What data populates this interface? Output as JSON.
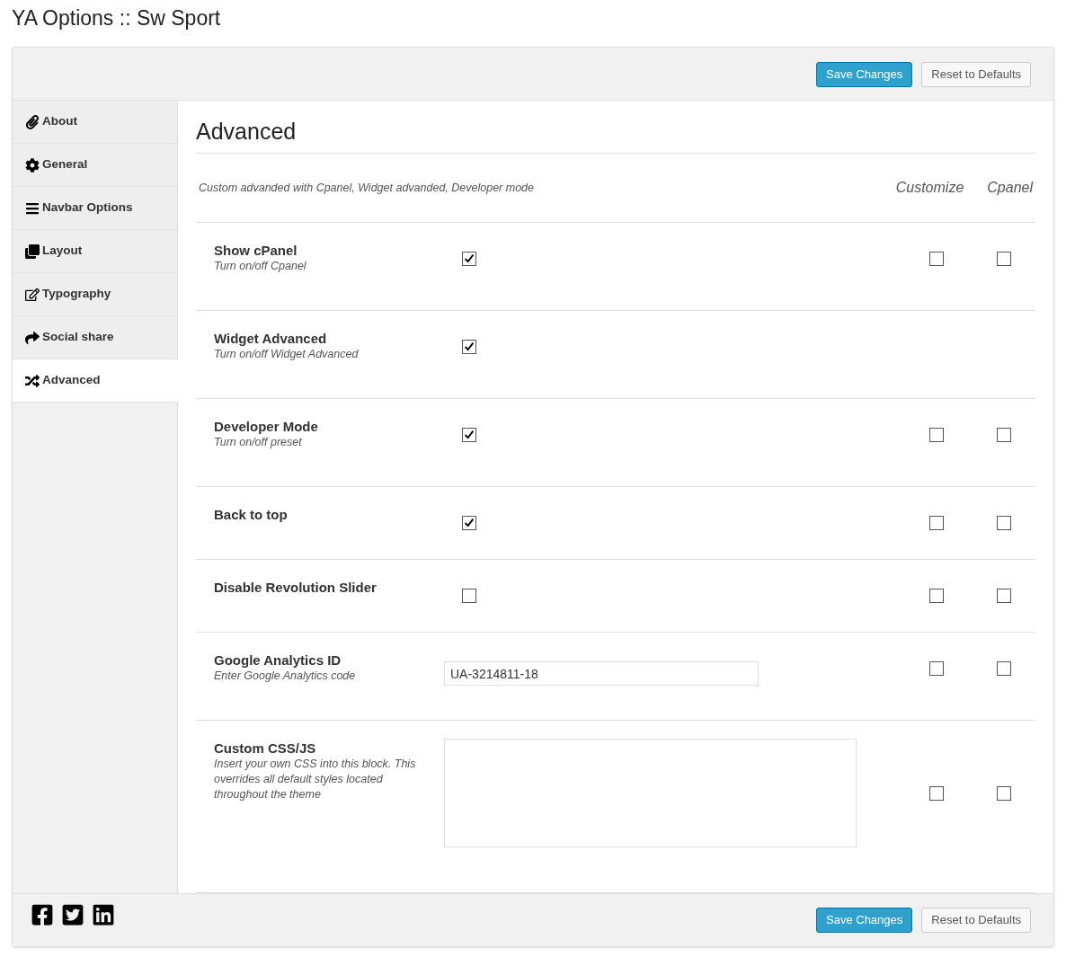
{
  "page_title": "YA Options :: Sw Sport",
  "header_buttons": [
    {
      "label": "Save Changes",
      "kind": "primary"
    },
    {
      "label": "Reset to Defaults",
      "kind": "secondary"
    }
  ],
  "sidebar": {
    "items": [
      {
        "label": "About",
        "selected": false
      },
      {
        "label": "General",
        "selected": false
      },
      {
        "label": "Navbar Options",
        "selected": false
      },
      {
        "label": "Layout",
        "selected": false
      },
      {
        "label": "Typography",
        "selected": false
      },
      {
        "label": "Social share",
        "selected": false
      },
      {
        "label": "Advanced",
        "selected": true
      }
    ]
  },
  "section": {
    "title": "Advanced",
    "description": "Custom advanded with Cpanel, Widget advanded, Developer mode",
    "columns": [
      "Customize",
      "Cpanel"
    ]
  },
  "rows": [
    {
      "kind": "checkbox",
      "label": "Show cPanel",
      "hint": "Turn on/off Cpanel",
      "checked": true,
      "options": [
        {
          "checked": false
        },
        {
          "checked": false
        }
      ]
    },
    {
      "kind": "checkbox",
      "label": "Widget Advanced",
      "hint": "Turn on/off Widget Advanced",
      "checked": true,
      "options": []
    },
    {
      "kind": "checkbox",
      "label": "Developer Mode",
      "hint": "Turn on/off preset",
      "checked": true,
      "options": [
        {
          "checked": false
        },
        {
          "checked": false
        }
      ]
    },
    {
      "kind": "checkbox",
      "label": "Back to top",
      "checked": true,
      "options": [
        {
          "checked": false
        },
        {
          "checked": false
        }
      ]
    },
    {
      "kind": "checkbox",
      "label": "Disable Revolution Slider",
      "checked": false,
      "options": [
        {
          "checked": false
        },
        {
          "checked": false
        }
      ]
    },
    {
      "kind": "text",
      "label": "Google Analytics ID",
      "hint": "Enter Google Analytics code",
      "value": "UA-3214811-18",
      "options": [
        {
          "checked": false
        },
        {
          "checked": false
        }
      ]
    },
    {
      "kind": "textarea",
      "label": "Custom CSS/JS",
      "hint": "Insert your own CSS into this block. This overrides all default styles located throughout the theme",
      "value": "",
      "options": [
        {
          "checked": false
        },
        {
          "checked": false
        }
      ]
    }
  ],
  "footer_buttons": [
    {
      "label": "Save Changes",
      "kind": "primary"
    },
    {
      "label": "Reset to Defaults",
      "kind": "secondary"
    }
  ]
}
